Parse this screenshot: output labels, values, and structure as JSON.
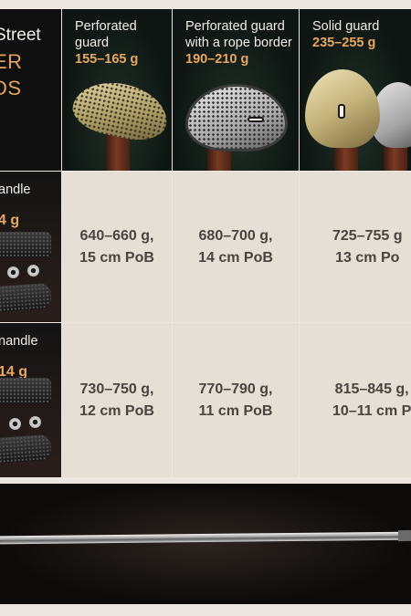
{
  "brand": {
    "line1": "Street",
    "line2": "ER",
    "line3": "DS"
  },
  "guards": [
    {
      "name_line1": "Perforated",
      "name_line2": "guard",
      "weight": "155–165 g"
    },
    {
      "name_line1": "Perforated guard",
      "name_line2": "with a rope border",
      "weight": "190–210 g"
    },
    {
      "name_line1": "Solid guard",
      "name_line2": "",
      "weight": "235–255 g"
    }
  ],
  "handles": [
    {
      "label": "andle",
      "weight": "4 g",
      "cells": [
        {
          "line1": "640–660 g,",
          "line2": "15 cm PoB"
        },
        {
          "line1": "680–700 g,",
          "line2": "14 cm PoB"
        },
        {
          "line1": "725–755 g",
          "line2": "13 cm Po"
        }
      ]
    },
    {
      "label": "nandle",
      "weight": "14 g",
      "cells": [
        {
          "line1": "730–750 g,",
          "line2": "12 cm PoB"
        },
        {
          "line1": "770–790 g,",
          "line2": "11 cm PoB"
        },
        {
          "line1": "815–845 g,",
          "line2": "10–11 cm P"
        }
      ]
    }
  ],
  "colors": {
    "accent": "#e9a861",
    "cell_bg": "#e5dfd6",
    "cell_text": "#4a4440"
  }
}
